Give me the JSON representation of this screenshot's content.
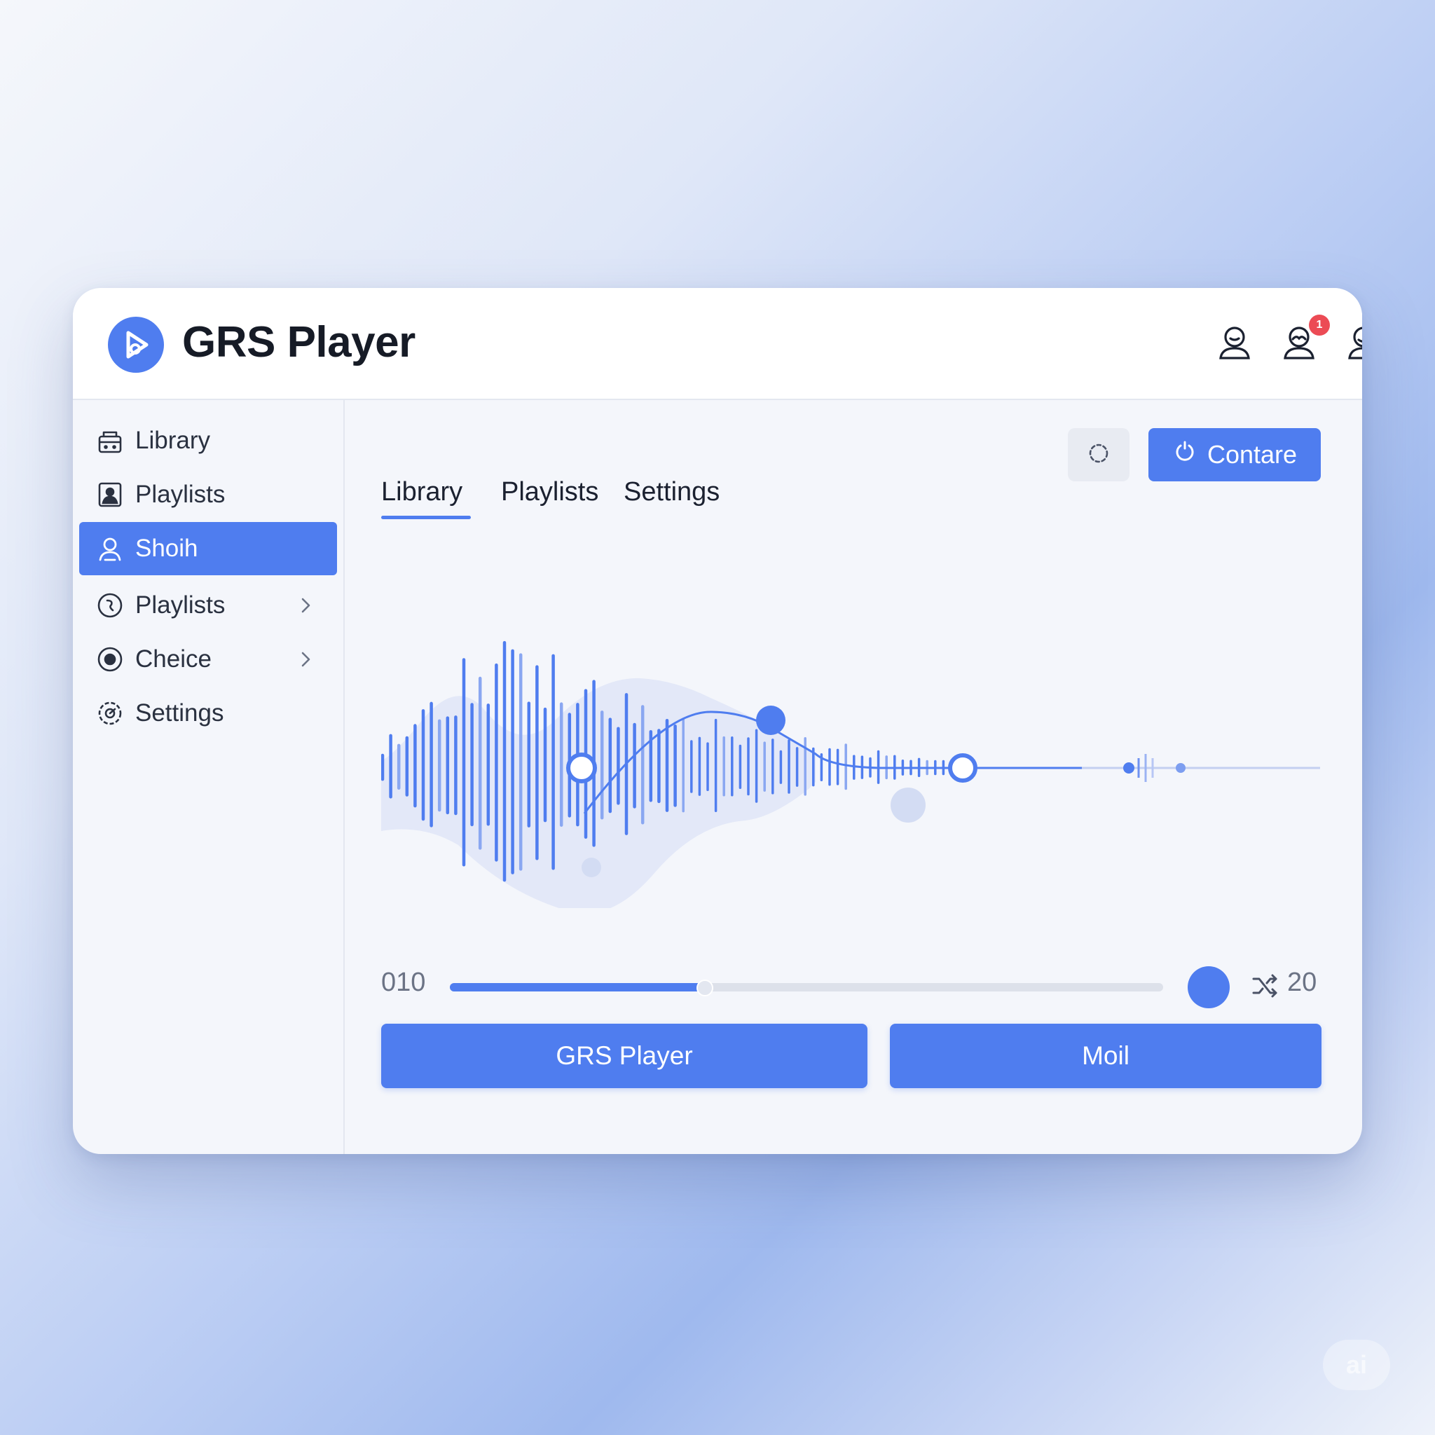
{
  "header": {
    "title": "GRS Player",
    "logo_icon": "play-logo-icon",
    "icons": [
      "user-icon",
      "user-mustache-icon",
      "user-notification-icon"
    ],
    "notification_count": "1"
  },
  "sidebar": {
    "items": [
      {
        "label": "Library",
        "icon": "library-icon",
        "active": false,
        "chevron": false
      },
      {
        "label": "Playlists",
        "icon": "portrait-icon",
        "active": false,
        "chevron": false
      },
      {
        "label": "Shoih",
        "icon": "user-icon",
        "active": true,
        "chevron": false
      },
      {
        "label": "Playlists",
        "icon": "playlist-circle-icon",
        "active": false,
        "chevron": true
      },
      {
        "label": "Cheice",
        "icon": "choice-circle-icon",
        "active": false,
        "chevron": true
      },
      {
        "label": "Settings",
        "icon": "settings-gear-icon",
        "active": false,
        "chevron": false
      }
    ]
  },
  "main": {
    "tabs": [
      {
        "label": "Library",
        "active": true
      },
      {
        "label": "Playlists",
        "active": false
      },
      {
        "label": "Settings",
        "active": false
      }
    ],
    "toolbar": {
      "refresh_icon": "refresh-icon",
      "primary_label": "Contare",
      "primary_icon": "power-icon"
    },
    "player": {
      "time_current": "010",
      "time_total": "20",
      "progress": 0.356,
      "shuffle_icon": "shuffle-icon"
    },
    "actions": {
      "left_label": "GRS Player",
      "right_label": "Moil"
    }
  },
  "colors": {
    "accent": "#4f7def",
    "text": "#1b2130",
    "badge": "#ec4b55"
  },
  "watermark": "ai"
}
